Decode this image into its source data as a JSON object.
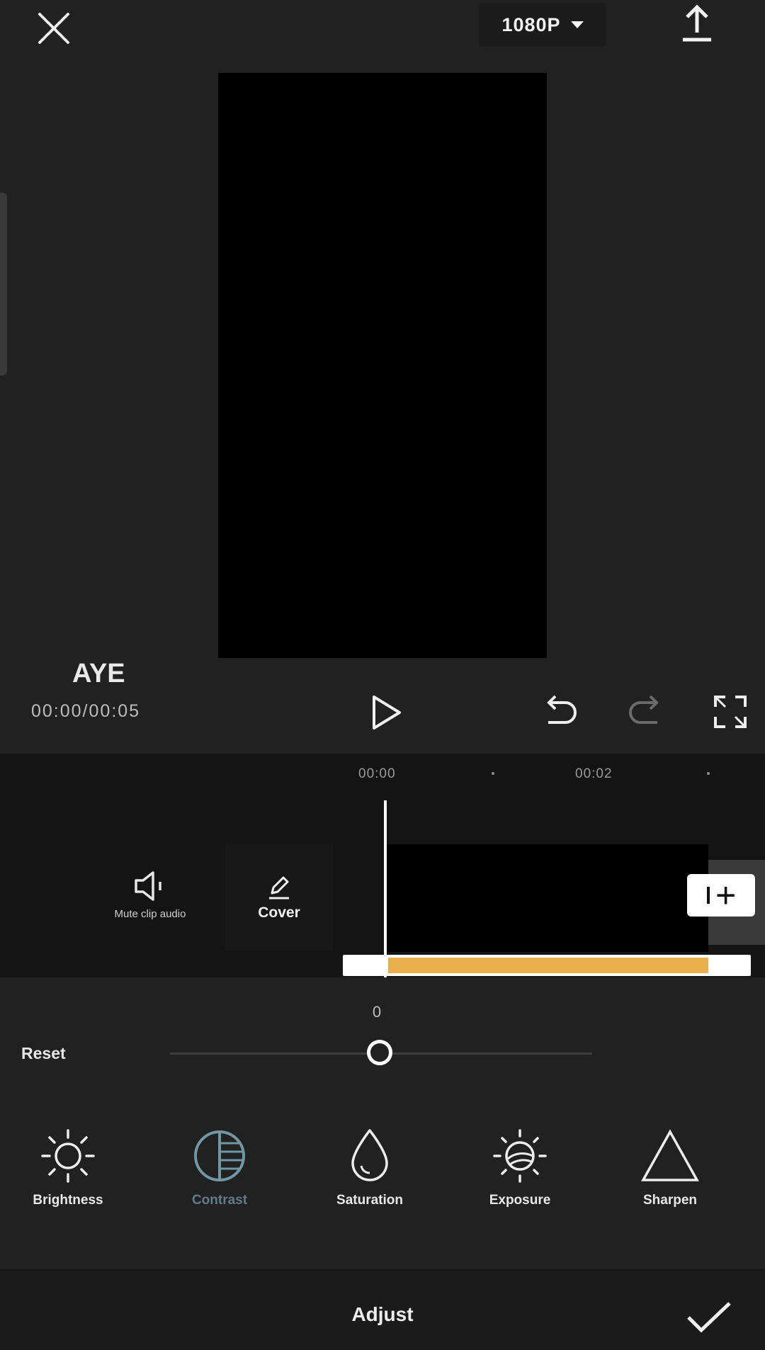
{
  "topbar": {
    "resolution": "1080P"
  },
  "project": {
    "title": "AYE",
    "timecode": "00:00/00:05"
  },
  "timeline": {
    "ruler_labels": [
      "00:00",
      "00:02"
    ],
    "mute_label": "Mute clip audio",
    "cover_label": "Cover"
  },
  "adjust": {
    "value": "0",
    "slider_fraction": 0.5,
    "reset_label": "Reset",
    "tools": [
      {
        "label": "Brightness",
        "icon": "sun-icon"
      },
      {
        "label": "Contrast",
        "icon": "contrast-icon",
        "active": true
      },
      {
        "label": "Saturation",
        "icon": "drop-icon"
      },
      {
        "label": "Exposure",
        "icon": "exposure-icon"
      },
      {
        "label": "Sharpen",
        "icon": "triangle-icon"
      }
    ]
  },
  "bottom": {
    "title": "Adjust"
  },
  "colors": {
    "background": "#212121",
    "timeline": "#141414",
    "audio_fill": "#e7b04d",
    "active_tool": "#5f7d86"
  }
}
